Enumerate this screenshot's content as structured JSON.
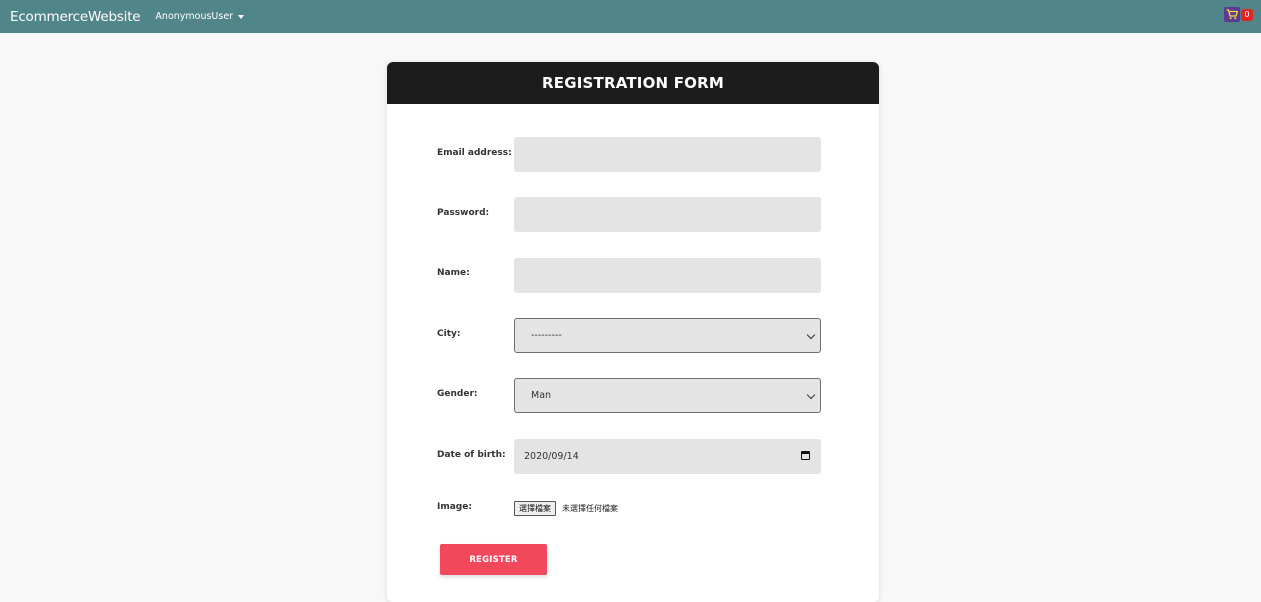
{
  "navbar": {
    "brand": "EcommerceWebsite",
    "user_menu": "AnonymousUser",
    "cart_count": "0"
  },
  "form": {
    "title": "REGISTRATION FORM",
    "email_label": "Email address:",
    "email_value": "",
    "password_label": "Password:",
    "password_value": "",
    "name_label": "Name:",
    "name_value": "",
    "city_label": "City:",
    "city_selected": "---------",
    "gender_label": "Gender:",
    "gender_selected": "Man",
    "dob_label": "Date of birth:",
    "dob_value": "2020/09/14",
    "image_label": "Image:",
    "file_button": "選擇檔案",
    "file_status": "未選擇任何檔案",
    "register_button": "REGISTER"
  },
  "colors": {
    "navbar": "#508589",
    "card_header": "#1c1c1c",
    "register_button": "#f2485c",
    "cart_badge": "#e8231f"
  },
  "icons": [
    "shopping-cart-icon",
    "caret-down-icon",
    "chevron-down-icon",
    "calendar-icon"
  ]
}
